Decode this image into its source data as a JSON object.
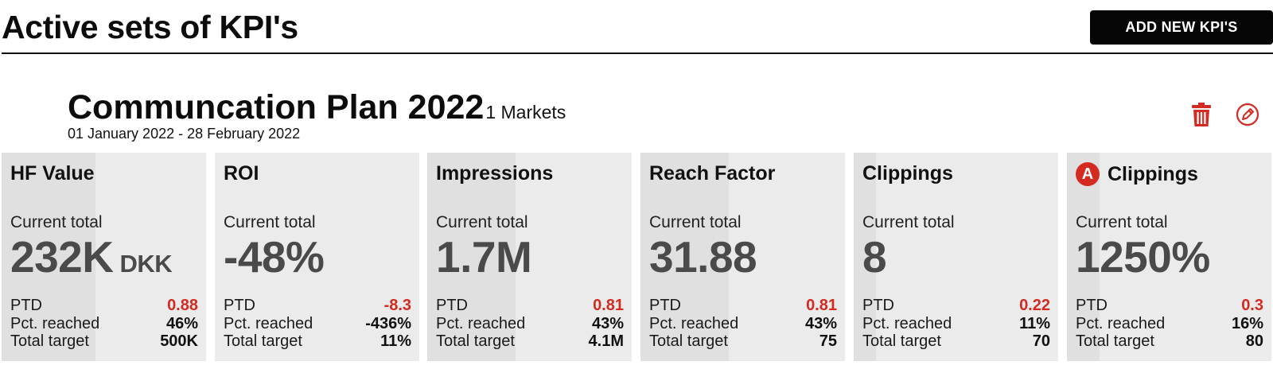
{
  "header": {
    "title": "Active sets of KPI's",
    "add_button_label": "ADD NEW KPI'S"
  },
  "plan": {
    "name": "Communcation Plan 2022",
    "markets": "1 Markets",
    "date_range": "01 January 2022 - 28 February 2022"
  },
  "colors": {
    "accent_red": "#d32a22",
    "button_bg": "#050505",
    "card_bg": "#ebebeb",
    "card_progress_band": "#e0e0e0",
    "value_gray": "#4a4a4a"
  },
  "icons": {
    "delete": "trash-icon",
    "edit": "pencil-icon"
  },
  "labels": {
    "current_total": "Current total",
    "ptd": "PTD",
    "pct_reached": "Pct. reached",
    "total_target": "Total target"
  },
  "kpis": [
    {
      "title": "HF Value",
      "badge": "",
      "value": "232K",
      "unit": "DKK",
      "ptd": "0.88",
      "pct_reached": "46%",
      "total_target": "500K",
      "progress": 0.46
    },
    {
      "title": "ROI",
      "badge": "",
      "value": "-48%",
      "unit": "",
      "ptd": "-8.3",
      "pct_reached": "-436%",
      "total_target": "11%",
      "progress": 0
    },
    {
      "title": "Impressions",
      "badge": "",
      "value": "1.7M",
      "unit": "",
      "ptd": "0.81",
      "pct_reached": "43%",
      "total_target": "4.1M",
      "progress": 0.43
    },
    {
      "title": "Reach Factor",
      "badge": "",
      "value": "31.88",
      "unit": "",
      "ptd": "0.81",
      "pct_reached": "43%",
      "total_target": "75",
      "progress": 0.43
    },
    {
      "title": "Clippings",
      "badge": "",
      "value": "8",
      "unit": "",
      "ptd": "0.22",
      "pct_reached": "11%",
      "total_target": "70",
      "progress": 0.11
    },
    {
      "title": "Clippings",
      "badge": "A",
      "value": "1250%",
      "unit": "",
      "ptd": "0.3",
      "pct_reached": "16%",
      "total_target": "80",
      "progress": 0.16
    }
  ]
}
